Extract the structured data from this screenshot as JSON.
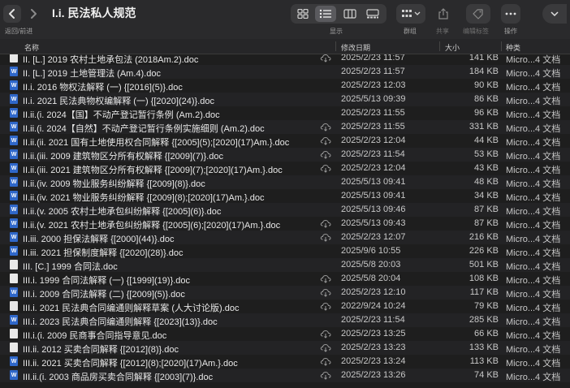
{
  "toolbar": {
    "title": "I.i. 民法私人规范",
    "nav_label": "返回/前进",
    "view_label": "显示",
    "group_label": "群组",
    "share_label": "共享",
    "tag_label": "编辑标签",
    "action_label": "操作"
  },
  "columns": {
    "name": "名称",
    "date": "修改日期",
    "size": "大小",
    "kind": "种类"
  },
  "files": [
    {
      "name": "II. [L.] 2019 农村土地承包法 (2018Am.2).doc",
      "date": "2025/2/23 11:57",
      "size": "141 KB",
      "kind": "Micro...4 文档",
      "icon": "plain",
      "cloud": true
    },
    {
      "name": "II. [L.] 2019 土地管理法 (Am.4).doc",
      "date": "2025/2/23 11:57",
      "size": "184 KB",
      "kind": "Micro...4 文档",
      "icon": "word",
      "cloud": false
    },
    {
      "name": "II.i. 2016 物权法解释 (一) {[2016](5)}.doc",
      "date": "2025/2/23 12:03",
      "size": "90 KB",
      "kind": "Micro...4 文档",
      "icon": "word",
      "cloud": false
    },
    {
      "name": "II.i. 2021 民法典物权编解释 (一) {[2020](24)}.doc",
      "date": "2025/5/13 09:39",
      "size": "86 KB",
      "kind": "Micro...4 文档",
      "icon": "word",
      "cloud": false
    },
    {
      "name": "II.ii.(i. 2024【国】不动产登记暂行条例 (Am.2).doc",
      "date": "2025/2/23 11:55",
      "size": "96 KB",
      "kind": "Micro...4 文档",
      "icon": "word",
      "cloud": false
    },
    {
      "name": "II.ii.(i. 2024【自然】不动产登记暂行条例实施细则 (Am.2).doc",
      "date": "2025/2/23 11:55",
      "size": "331 KB",
      "kind": "Micro...4 文档",
      "icon": "word",
      "cloud": true
    },
    {
      "name": "II.ii.(ii. 2021 国有土地使用权合同解释 {[2005](5);[2020](17)Am.}.doc",
      "date": "2025/2/23 12:04",
      "size": "44 KB",
      "kind": "Micro...4 文档",
      "icon": "word",
      "cloud": true
    },
    {
      "name": "II.ii.(iii. 2009 建筑物区分所有权解释 {[2009](7)}.doc",
      "date": "2025/2/23 11:54",
      "size": "53 KB",
      "kind": "Micro...4 文档",
      "icon": "word",
      "cloud": true
    },
    {
      "name": "II.ii.(iii. 2021 建筑物区分所有权解释 {[2009](7);[2020](17)Am.}.doc",
      "date": "2025/2/23 12:04",
      "size": "43 KB",
      "kind": "Micro...4 文档",
      "icon": "word",
      "cloud": true
    },
    {
      "name": "II.ii.(iv. 2009 物业服务纠纷解释 {[2009](8)}.doc",
      "date": "2025/5/13 09:41",
      "size": "48 KB",
      "kind": "Micro...4 文档",
      "icon": "word",
      "cloud": false
    },
    {
      "name": "II.ii.(iv. 2021 物业服务纠纷解释 {[2009](8);[2020](17)Am.}.doc",
      "date": "2025/5/13 09:41",
      "size": "34 KB",
      "kind": "Micro...4 文档",
      "icon": "word",
      "cloud": false
    },
    {
      "name": "II.ii.(v. 2005 农村土地承包纠纷解释 {[2005](6)}.doc",
      "date": "2025/5/13 09:46",
      "size": "87 KB",
      "kind": "Micro...4 文档",
      "icon": "word",
      "cloud": false
    },
    {
      "name": "II.ii.(v. 2021 农村土地承包纠纷解释 {[2005](6);[2020](17)Am.}.doc",
      "date": "2025/5/13 09:43",
      "size": "87 KB",
      "kind": "Micro...4 文档",
      "icon": "word",
      "cloud": true
    },
    {
      "name": "II.iii. 2000 担保法解释 {[2000](44)}.doc",
      "date": "2025/2/23 12:07",
      "size": "216 KB",
      "kind": "Micro...4 文档",
      "icon": "word",
      "cloud": true
    },
    {
      "name": "II.iii. 2021 担保制度解释 {[2020](28)}.doc",
      "date": "2025/9/6 10:55",
      "size": "226 KB",
      "kind": "Micro...4 文档",
      "icon": "word",
      "cloud": false
    },
    {
      "name": "III. [C.] 1999 合同法.doc",
      "date": "2025/5/8 20:03",
      "size": "501 KB",
      "kind": "Micro...4 文档",
      "icon": "plain",
      "cloud": false
    },
    {
      "name": "III.i. 1999 合同法解释 (一) {[1999](19)}.doc",
      "date": "2025/5/8 20:04",
      "size": "108 KB",
      "kind": "Micro...4 文档",
      "icon": "plain",
      "cloud": true
    },
    {
      "name": "III.i. 2009 合同法解释 (二) {[2009](5)}.doc",
      "date": "2025/2/23 12:10",
      "size": "117 KB",
      "kind": "Micro...4 文档",
      "icon": "word",
      "cloud": true
    },
    {
      "name": "III.i. 2021 民法典合同编通则解释草案 (人大讨论版).doc",
      "date": "2022/9/24 10:24",
      "size": "79 KB",
      "kind": "Micro...4 文档",
      "icon": "plain",
      "cloud": true
    },
    {
      "name": "III.i. 2023 民法典合同编通则解释 {[2023](13)}.doc",
      "date": "2025/2/23 11:54",
      "size": "285 KB",
      "kind": "Micro...4 文档",
      "icon": "word",
      "cloud": false
    },
    {
      "name": "III.i.(i. 2009 民商事合同指导意见.doc",
      "date": "2025/2/23 13:25",
      "size": "66 KB",
      "kind": "Micro...4 文档",
      "icon": "plain",
      "cloud": true
    },
    {
      "name": "III.ii. 2012 买卖合同解释 {[2012](8)}.doc",
      "date": "2025/2/23 13:23",
      "size": "133 KB",
      "kind": "Micro...4 文档",
      "icon": "plain",
      "cloud": true
    },
    {
      "name": "III.ii. 2021 买卖合同解释 {[2012](8);[2020](17)Am.}.doc",
      "date": "2025/2/23 13:24",
      "size": "113 KB",
      "kind": "Micro...4 文档",
      "icon": "word",
      "cloud": true
    },
    {
      "name": "III.ii.(i. 2003 商品房买卖合同解释 {[2003](7)}.doc",
      "date": "2025/2/23 13:26",
      "size": "74 KB",
      "kind": "Micro...4 文档",
      "icon": "word",
      "cloud": true
    }
  ]
}
